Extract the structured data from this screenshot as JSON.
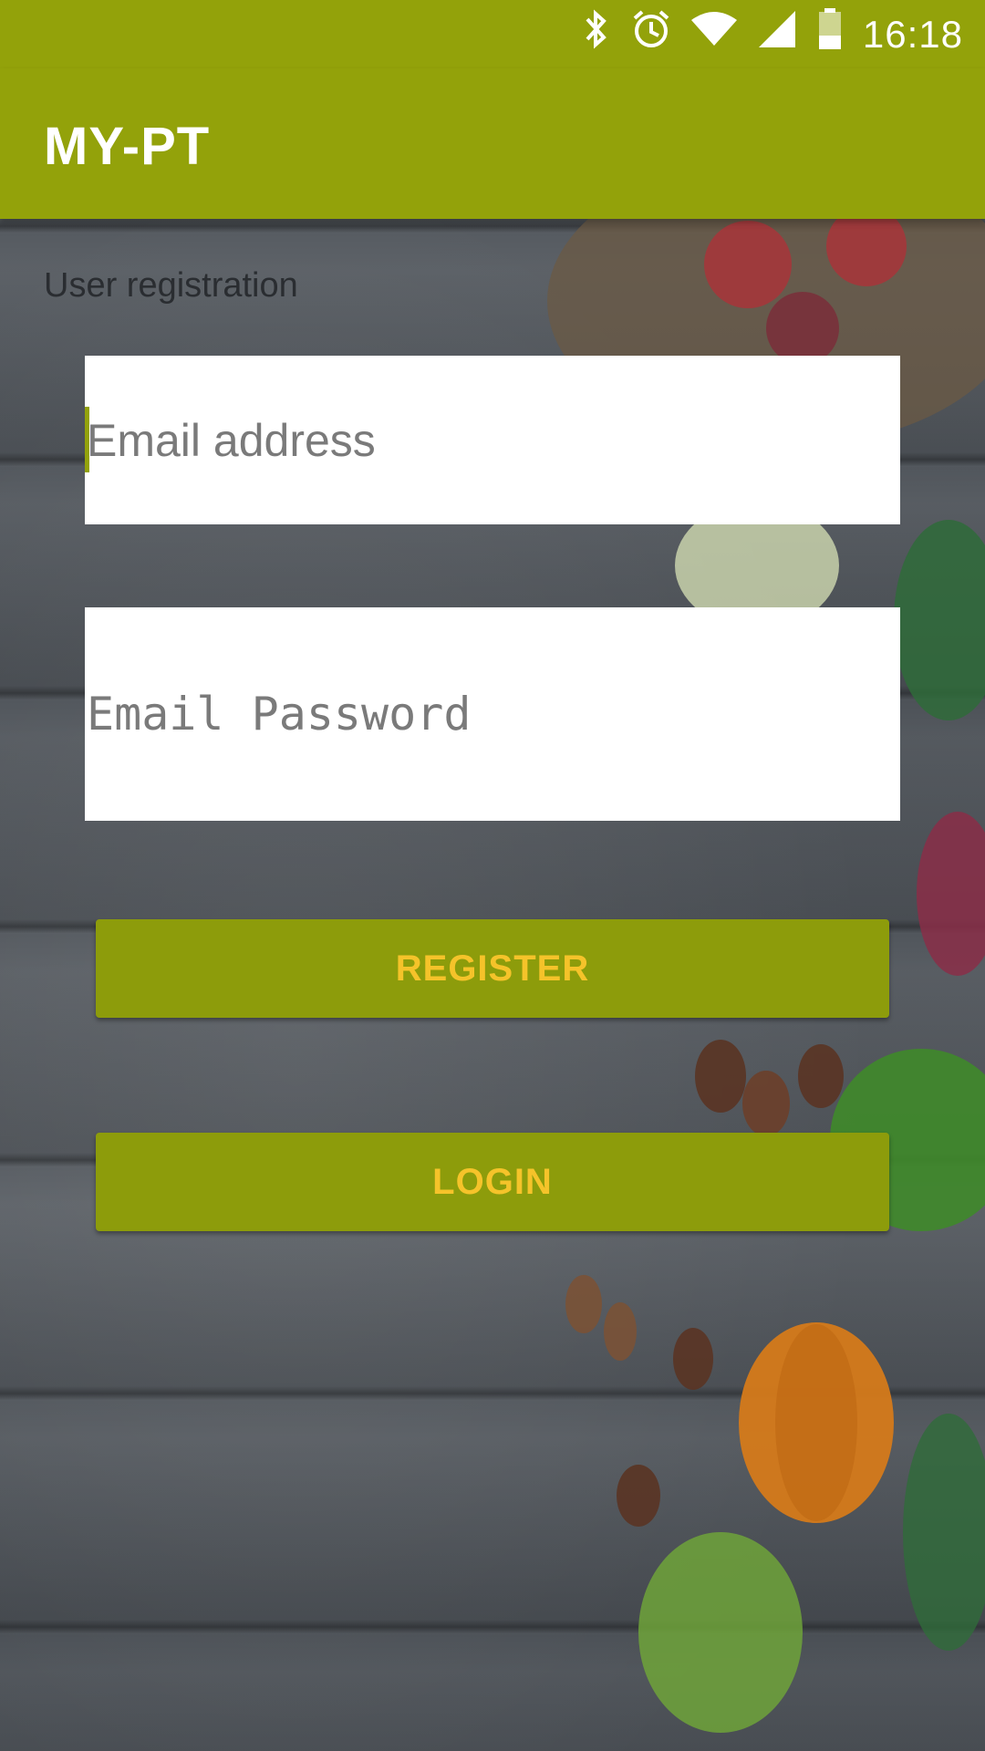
{
  "status_bar": {
    "time": "16:18",
    "icons": [
      "bluetooth-icon",
      "alarm-icon",
      "wifi-icon",
      "signal-icon",
      "battery-icon"
    ]
  },
  "app_bar": {
    "title": "MY-PT"
  },
  "screen": {
    "section_label": "User registration",
    "email_field": {
      "value": "",
      "placeholder": "Email address"
    },
    "password_field": {
      "value": "",
      "placeholder": "Email Password"
    },
    "register_button": "REGISTER",
    "login_button": "LOGIN"
  },
  "colors": {
    "accent": "#93a20a",
    "button": "#8d9c0b",
    "button_text": "#f5c32a"
  }
}
